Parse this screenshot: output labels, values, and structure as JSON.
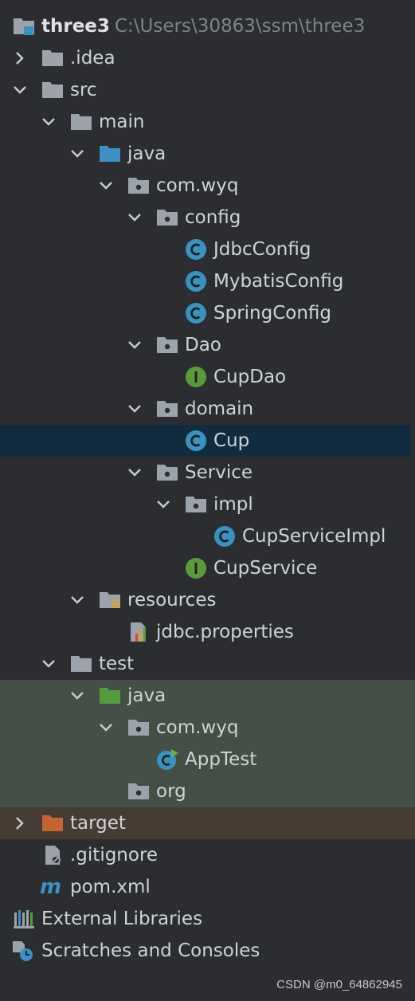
{
  "project": {
    "name": "three3",
    "path": "C:\\Users\\30863\\ssm\\three3"
  },
  "items": {
    "idea": ".idea",
    "src": "src",
    "main": "main",
    "java_main": "java",
    "com_wyq_main": "com.wyq",
    "config": "config",
    "jdbc_config": "JdbcConfig",
    "mybatis_config": "MybatisConfig",
    "spring_config": "SpringConfig",
    "dao": "Dao",
    "cup_dao": "CupDao",
    "domain": "domain",
    "cup": "Cup",
    "service": "Service",
    "impl": "impl",
    "cup_service_impl": "CupServiceImpl",
    "cup_service": "CupService",
    "resources": "resources",
    "jdbc_properties": "jdbc.properties",
    "test": "test",
    "java_test": "java",
    "com_wyq_test": "com.wyq",
    "app_test": "AppTest",
    "org": "org",
    "target": "target",
    "gitignore": ".gitignore",
    "pom": "pom.xml",
    "external_libraries": "External Libraries",
    "scratches": "Scratches and Consoles"
  },
  "icons": {
    "C": "C",
    "I": "I",
    "m": "m"
  },
  "colors": {
    "background": "#2b2d30",
    "selected": "#112c3f",
    "test_bg": "#444f45",
    "target_bg": "#463c34",
    "folder": "#9da3ab",
    "source_folder": "#3d90c1",
    "test_folder": "#549a3f",
    "excluded_folder": "#c26434",
    "class_icon": "#3a92bd",
    "interface_icon": "#5b9a3c"
  },
  "watermark": "CSDN @m0_64862945"
}
